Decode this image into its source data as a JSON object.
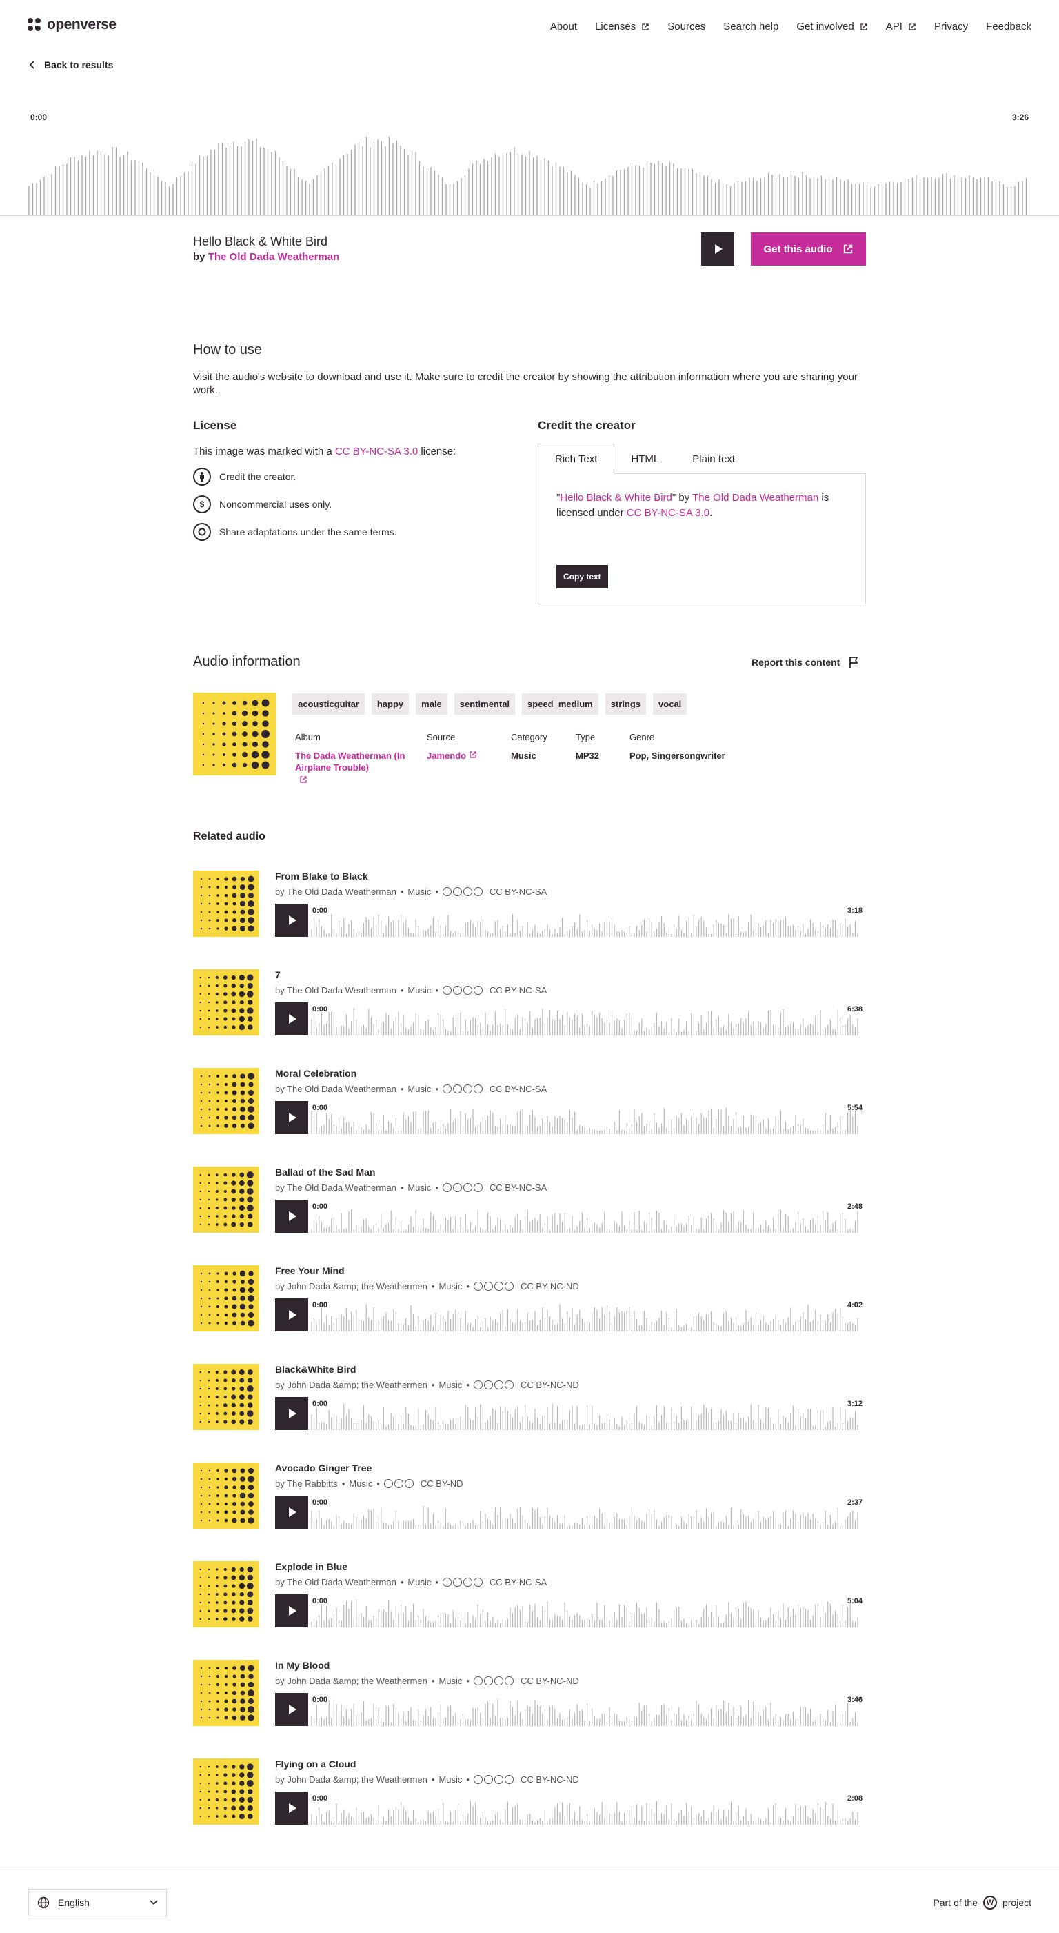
{
  "brand": {
    "name": "openverse"
  },
  "nav": {
    "items": [
      "About",
      "Licenses",
      "Sources",
      "Search help",
      "Get involved",
      "API",
      "Privacy",
      "Feedback"
    ]
  },
  "back_label": "Back to results",
  "player": {
    "time_start": "0:00",
    "time_end": "3:26"
  },
  "audio": {
    "title": "Hello Black & White Bird",
    "by": "by",
    "creator": "The Old Dada Weatherman",
    "get_label": "Get this audio"
  },
  "how_to_use": {
    "heading": "How to use",
    "text": "Visit the audio's website to download and use it. Make sure to credit the creator by showing the attribution information where you are sharing your work."
  },
  "license": {
    "heading": "License",
    "intro_pre": "This image was marked with a",
    "license_name": "CC BY-NC-SA 3.0",
    "intro_post": "license:",
    "terms": [
      "Credit the creator.",
      "Noncommercial uses only.",
      "Share adaptations under the same terms."
    ]
  },
  "credit": {
    "heading": "Credit the creator",
    "tabs": [
      "Rich Text",
      "HTML",
      "Plain text"
    ],
    "q1": "\"",
    "title": "Hello Black & White Bird",
    "q2": "\" by",
    "creator": "The Old Dada Weatherman",
    "is": "is",
    "licensed_under": "licensed under",
    "license": "CC BY-NC-SA 3.0",
    "period": ".",
    "copy_label": "Copy text"
  },
  "info": {
    "heading": "Audio information",
    "report_label": "Report this content",
    "tags": [
      "acousticguitar",
      "happy",
      "male",
      "sentimental",
      "speed_medium",
      "strings",
      "vocal"
    ],
    "album_label": "Album",
    "album_value": "The Dada Weatherman (In Airplane Trouble)",
    "source_label": "Source",
    "source_value": "Jamendo",
    "category_label": "Category",
    "category_value": "Music",
    "type_label": "Type",
    "type_value": "MP32",
    "genre_label": "Genre",
    "genre_value": "Pop, Singersongwriter"
  },
  "related": {
    "heading": "Related audio",
    "sep": "•",
    "items": [
      {
        "title": "From Blake to Black",
        "creator": "by The Old Dada Weatherman",
        "category": "Music",
        "license": "CC BY-NC-SA",
        "icons": 4,
        "start": "0:00",
        "duration": "3:18"
      },
      {
        "title": "7",
        "creator": "by The Old Dada Weatherman",
        "category": "Music",
        "license": "CC BY-NC-SA",
        "icons": 4,
        "start": "0:00",
        "duration": "6:38"
      },
      {
        "title": "Moral Celebration",
        "creator": "by The Old Dada Weatherman",
        "category": "Music",
        "license": "CC BY-NC-SA",
        "icons": 4,
        "start": "0:00",
        "duration": "5:54"
      },
      {
        "title": "Ballad of the Sad Man",
        "creator": "by The Old Dada Weatherman",
        "category": "Music",
        "license": "CC BY-NC-SA",
        "icons": 4,
        "start": "0:00",
        "duration": "2:48"
      },
      {
        "title": "Free Your Mind",
        "creator": "by John Dada &amp; the Weathermen",
        "category": "Music",
        "license": "CC BY-NC-ND",
        "icons": 4,
        "start": "0:00",
        "duration": "4:02"
      },
      {
        "title": "Black&White Bird",
        "creator": "by John Dada &amp; the Weathermen",
        "category": "Music",
        "license": "CC BY-NC-ND",
        "icons": 4,
        "start": "0:00",
        "duration": "3:12"
      },
      {
        "title": "Avocado Ginger Tree",
        "creator": "by The Rabbitts",
        "category": "Music",
        "license": "CC BY-ND",
        "icons": 3,
        "start": "0:00",
        "duration": "2:37"
      },
      {
        "title": "Explode in Blue",
        "creator": "by The Old Dada Weatherman",
        "category": "Music",
        "license": "CC BY-NC-SA",
        "icons": 4,
        "start": "0:00",
        "duration": "5:04"
      },
      {
        "title": "In My Blood",
        "creator": "by John Dada &amp; the Weathermen",
        "category": "Music",
        "license": "CC BY-NC-ND",
        "icons": 4,
        "start": "0:00",
        "duration": "3:46"
      },
      {
        "title": "Flying on a Cloud",
        "creator": "by John Dada &amp; the Weathermen",
        "category": "Music",
        "license": "CC BY-NC-ND",
        "icons": 4,
        "start": "0:00",
        "duration": "2:08"
      }
    ]
  },
  "footer": {
    "language": "English",
    "part_of": "Part of the",
    "project": "project"
  },
  "colors": {
    "accent": "#c52b9b",
    "dark": "#30272e",
    "art_yellow": "#f7d93f"
  }
}
